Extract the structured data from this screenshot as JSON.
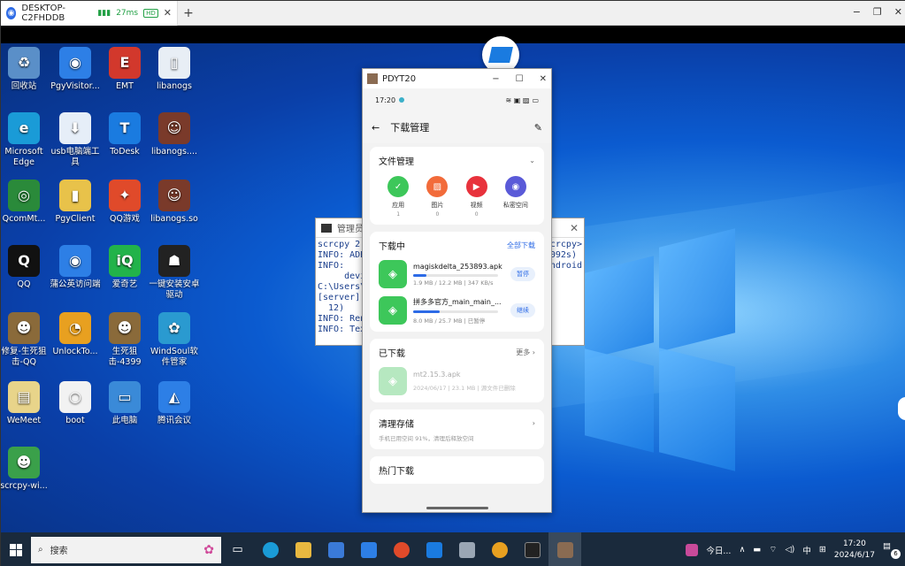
{
  "remote_tab": {
    "title": "DESKTOP-C2FHDDB",
    "latency": "27ms",
    "quality": "HD",
    "close": "✕",
    "new_tab": "+"
  },
  "window_controls": {
    "min": "−",
    "max": "❐",
    "close": "✕"
  },
  "desktop_icons": [
    {
      "label": "回收站",
      "glyph": "♻",
      "color": "#5a8fc8"
    },
    {
      "label": "PgyVisitor...",
      "glyph": "◉",
      "color": "#2d7fe6"
    },
    {
      "label": "EMT",
      "glyph": "E",
      "color": "#d2382c"
    },
    {
      "label": "libanogs",
      "glyph": "▯",
      "color": "#e8eef5"
    },
    {
      "label": "Microsoft\nEdge",
      "glyph": "e",
      "color": "#1a9bd7"
    },
    {
      "label": "usb电脑端工具",
      "glyph": "⬇",
      "color": "#e6eef8"
    },
    {
      "label": "ToDesk",
      "glyph": "T",
      "color": "#1a7be0"
    },
    {
      "label": "libanogs....",
      "glyph": "☺",
      "color": "#7a3a2a"
    },
    {
      "label": "QcomMt...",
      "glyph": "◎",
      "color": "#2a8a3a"
    },
    {
      "label": "PgyClient",
      "glyph": "▮",
      "color": "#e8c24a"
    },
    {
      "label": "QQ游戏",
      "glyph": "✦",
      "color": "#e04a2a"
    },
    {
      "label": "libanogs.so",
      "glyph": "☺",
      "color": "#7a3a2a"
    },
    {
      "label": "QQ",
      "glyph": "Q",
      "color": "#111111"
    },
    {
      "label": "蒲公英访问端",
      "glyph": "◉",
      "color": "#2d7fe6"
    },
    {
      "label": "爱奇艺",
      "glyph": "iQ",
      "color": "#22b34a"
    },
    {
      "label": "一键安装安卓驱动",
      "glyph": "☗",
      "color": "#222222"
    },
    {
      "label": "修复-生死狙击-QQ",
      "glyph": "☻",
      "color": "#8a6a3a"
    },
    {
      "label": "UnlockTo...",
      "glyph": "◔",
      "color": "#e8a020"
    },
    {
      "label": "生死狙击-4399",
      "glyph": "☻",
      "color": "#8a6a3a"
    },
    {
      "label": "WindSoul软件管家",
      "glyph": "✿",
      "color": "#2a9ad0"
    },
    {
      "label": "WeMeet",
      "glyph": "▤",
      "color": "#e8d48a"
    },
    {
      "label": "boot",
      "glyph": "○",
      "color": "#f2f2f2"
    },
    {
      "label": "此电脑",
      "glyph": "▭",
      "color": "#3a8ad8"
    },
    {
      "label": "腾讯会议",
      "glyph": "◭",
      "color": "#2d7fe6"
    },
    {
      "label": "scrcpy-wi...",
      "glyph": "☻",
      "color": "#3aa04a"
    }
  ],
  "cmd": {
    "title": "管理员",
    "close": "✕",
    "lines": [
      "scrcpy 2.",
      "INFO: ADB",
      "INFO:",
      "     devi",
      "C:\\Users\\",
      "[server]",
      "  12)",
      "INFO: Ren",
      "INFO: Tex"
    ],
    "right_lines": [
      "crcpy>",
      "",
      "",
      "",
      "092s)",
      "ndroid",
      "",
      "",
      ""
    ]
  },
  "phone_window": {
    "title": "PDYT20",
    "min": "−",
    "max": "☐",
    "close": "✕"
  },
  "status_bar": {
    "time": "17:20",
    "icons": "≋ ▣ ▨"
  },
  "nav": {
    "back": "←",
    "title": "下载管理",
    "edit": "✎"
  },
  "file_mgmt": {
    "title": "文件管理",
    "chevron": "⌄",
    "items": [
      {
        "label": "应用",
        "count": "1",
        "color": "#3dc75a",
        "glyph": "✓"
      },
      {
        "label": "图片",
        "count": "0",
        "color": "#f26b3a",
        "glyph": "▨"
      },
      {
        "label": "视频",
        "count": "0",
        "color": "#e8323c",
        "glyph": "▶"
      },
      {
        "label": "私密空间",
        "count": "",
        "color": "#5a5ad8",
        "glyph": "◉"
      }
    ]
  },
  "downloading": {
    "title": "下载中",
    "action": "全部下载",
    "items": [
      {
        "name": "magiskdelta_253893.apk",
        "meta": "1.9 MB / 12.2 MB  |  347 KB/s",
        "progress": 0.16,
        "button": "暂停"
      },
      {
        "name": "拼多多官方_main_main_...",
        "meta": "8.0 MB / 25.7 MB  |  已暂停",
        "progress": 0.31,
        "button": "继续"
      }
    ]
  },
  "downloaded": {
    "title": "已下载",
    "more": "更多 ›",
    "items": [
      {
        "name": "mt2.15.3.apk",
        "meta": "2024/06/17  |  23.1 MB  |  源文件已删除"
      }
    ]
  },
  "cleanup": {
    "title": "清理存储",
    "subtitle": "手机已用空间 91%，清理后释放空间",
    "chevron": "›"
  },
  "hot": {
    "title": "热门下载"
  },
  "taskbar": {
    "search_placeholder": "搜索",
    "news": "今日...",
    "ime": "中",
    "time": "17:20",
    "date": "2024/6/17",
    "notifications": "6"
  }
}
